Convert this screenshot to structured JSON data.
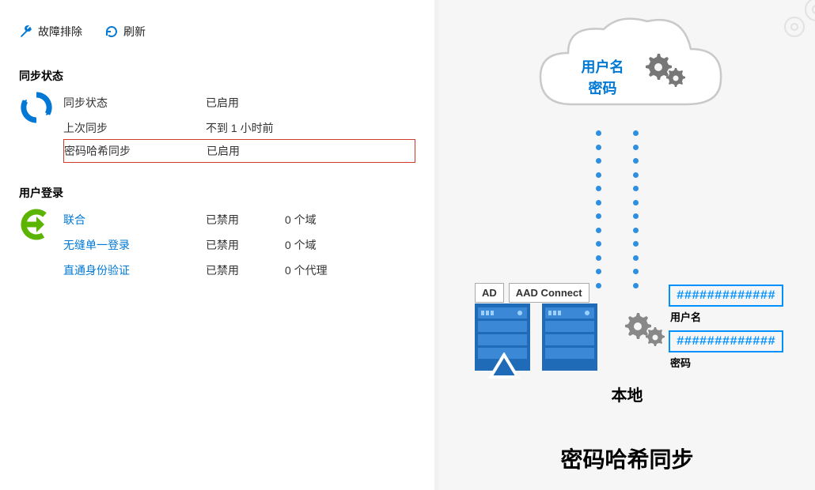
{
  "toolbar": {
    "troubleshoot": "故障排除",
    "refresh": "刷新"
  },
  "sync": {
    "title": "同步状态",
    "rows": [
      {
        "label": "同步状态",
        "value": "已启用"
      },
      {
        "label": "上次同步",
        "value": "不到 1 小时前"
      },
      {
        "label": "密码哈希同步",
        "value": "已启用"
      }
    ]
  },
  "login": {
    "title": "用户登录",
    "rows": [
      {
        "label": "联合",
        "value": "已禁用",
        "extra": "0 个域"
      },
      {
        "label": "无缝单一登录",
        "value": "已禁用",
        "extra": "0 个域"
      },
      {
        "label": "直通身份验证",
        "value": "已禁用",
        "extra": "0 个代理"
      }
    ]
  },
  "diagram": {
    "cloud_line1": "用户名",
    "cloud_line2": "密码",
    "server1": "AD",
    "server2": "AAD Connect",
    "hash1": "#############",
    "hash1_label": "用户名",
    "hash2": "#############",
    "hash2_label": "密码",
    "local": "本地",
    "title": "密码哈希同步"
  }
}
